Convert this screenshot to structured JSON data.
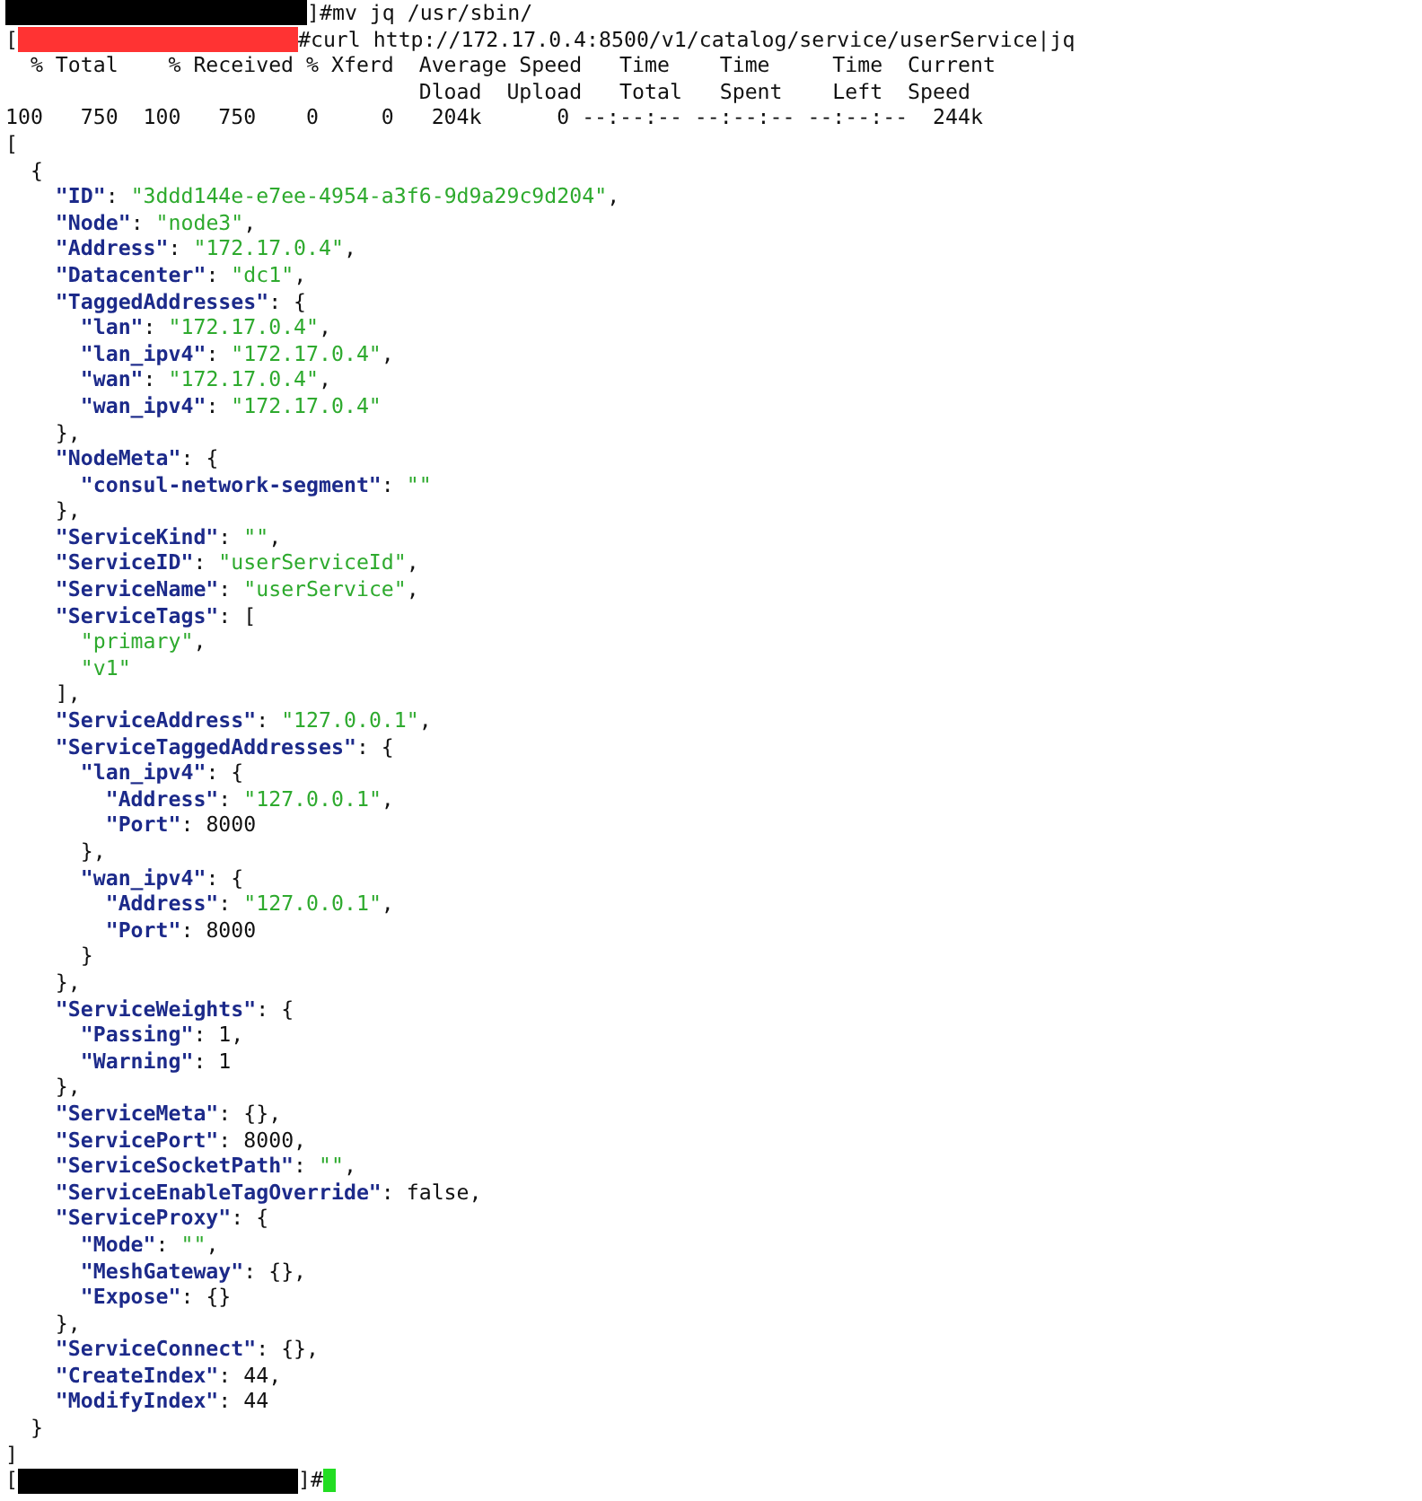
{
  "terminal": {
    "lines": [
      {
        "kind": "prompt",
        "color": "#000000",
        "command": "]#mv jq /usr/sbin/"
      },
      {
        "kind": "prompt",
        "prefix": "[",
        "color": "#ff3333",
        "command": "#curl http://172.17.0.4:8500/v1/catalog/service/userService|jq"
      },
      {
        "kind": "output",
        "text": "  % Total    % Received % Xferd  Average Speed   Time    Time     Time  Current"
      },
      {
        "kind": "output",
        "text": "                                 Dload  Upload   Total   Spent    Left  Speed"
      },
      {
        "kind": "output",
        "text": "100   750  100   750    0     0   204k      0 --:--:-- --:--:-- --:--:--  244k"
      },
      {
        "kind": "json",
        "tokens": [
          {
            "kind": "plain",
            "text": "["
          }
        ]
      },
      {
        "kind": "json",
        "tokens": [
          {
            "kind": "plain",
            "text": "  {"
          }
        ]
      },
      {
        "kind": "json",
        "tokens": [
          {
            "kind": "key",
            "text": "    \"ID\""
          },
          {
            "kind": "plain",
            "text": ": "
          },
          {
            "kind": "string",
            "text": "\"3ddd144e-e7ee-4954-a3f6-9d9a29c9d204\""
          },
          {
            "kind": "plain",
            "text": ","
          }
        ]
      },
      {
        "kind": "json",
        "tokens": [
          {
            "kind": "key",
            "text": "    \"Node\""
          },
          {
            "kind": "plain",
            "text": ": "
          },
          {
            "kind": "string",
            "text": "\"node3\""
          },
          {
            "kind": "plain",
            "text": ","
          }
        ]
      },
      {
        "kind": "json",
        "tokens": [
          {
            "kind": "key",
            "text": "    \"Address\""
          },
          {
            "kind": "plain",
            "text": ": "
          },
          {
            "kind": "string",
            "text": "\"172.17.0.4\""
          },
          {
            "kind": "plain",
            "text": ","
          }
        ]
      },
      {
        "kind": "json",
        "tokens": [
          {
            "kind": "key",
            "text": "    \"Datacenter\""
          },
          {
            "kind": "plain",
            "text": ": "
          },
          {
            "kind": "string",
            "text": "\"dc1\""
          },
          {
            "kind": "plain",
            "text": ","
          }
        ]
      },
      {
        "kind": "json",
        "tokens": [
          {
            "kind": "key",
            "text": "    \"TaggedAddresses\""
          },
          {
            "kind": "plain",
            "text": ": {"
          }
        ]
      },
      {
        "kind": "json",
        "tokens": [
          {
            "kind": "key",
            "text": "      \"lan\""
          },
          {
            "kind": "plain",
            "text": ": "
          },
          {
            "kind": "string",
            "text": "\"172.17.0.4\""
          },
          {
            "kind": "plain",
            "text": ","
          }
        ]
      },
      {
        "kind": "json",
        "tokens": [
          {
            "kind": "key",
            "text": "      \"lan_ipv4\""
          },
          {
            "kind": "plain",
            "text": ": "
          },
          {
            "kind": "string",
            "text": "\"172.17.0.4\""
          },
          {
            "kind": "plain",
            "text": ","
          }
        ]
      },
      {
        "kind": "json",
        "tokens": [
          {
            "kind": "key",
            "text": "      \"wan\""
          },
          {
            "kind": "plain",
            "text": ": "
          },
          {
            "kind": "string",
            "text": "\"172.17.0.4\""
          },
          {
            "kind": "plain",
            "text": ","
          }
        ]
      },
      {
        "kind": "json",
        "tokens": [
          {
            "kind": "key",
            "text": "      \"wan_ipv4\""
          },
          {
            "kind": "plain",
            "text": ": "
          },
          {
            "kind": "string",
            "text": "\"172.17.0.4\""
          }
        ]
      },
      {
        "kind": "json",
        "tokens": [
          {
            "kind": "plain",
            "text": "    },"
          }
        ]
      },
      {
        "kind": "json",
        "tokens": [
          {
            "kind": "key",
            "text": "    \"NodeMeta\""
          },
          {
            "kind": "plain",
            "text": ": {"
          }
        ]
      },
      {
        "kind": "json",
        "tokens": [
          {
            "kind": "key",
            "text": "      \"consul-network-segment\""
          },
          {
            "kind": "plain",
            "text": ": "
          },
          {
            "kind": "string",
            "text": "\"\""
          }
        ]
      },
      {
        "kind": "json",
        "tokens": [
          {
            "kind": "plain",
            "text": "    },"
          }
        ]
      },
      {
        "kind": "json",
        "tokens": [
          {
            "kind": "key",
            "text": "    \"ServiceKind\""
          },
          {
            "kind": "plain",
            "text": ": "
          },
          {
            "kind": "string",
            "text": "\"\""
          },
          {
            "kind": "plain",
            "text": ","
          }
        ]
      },
      {
        "kind": "json",
        "tokens": [
          {
            "kind": "key",
            "text": "    \"ServiceID\""
          },
          {
            "kind": "plain",
            "text": ": "
          },
          {
            "kind": "string",
            "text": "\"userServiceId\""
          },
          {
            "kind": "plain",
            "text": ","
          }
        ]
      },
      {
        "kind": "json",
        "tokens": [
          {
            "kind": "key",
            "text": "    \"ServiceName\""
          },
          {
            "kind": "plain",
            "text": ": "
          },
          {
            "kind": "string",
            "text": "\"userService\""
          },
          {
            "kind": "plain",
            "text": ","
          }
        ]
      },
      {
        "kind": "json",
        "tokens": [
          {
            "kind": "key",
            "text": "    \"ServiceTags\""
          },
          {
            "kind": "plain",
            "text": ": ["
          }
        ]
      },
      {
        "kind": "json",
        "tokens": [
          {
            "kind": "string",
            "text": "      \"primary\""
          },
          {
            "kind": "plain",
            "text": ","
          }
        ]
      },
      {
        "kind": "json",
        "tokens": [
          {
            "kind": "string",
            "text": "      \"v1\""
          }
        ]
      },
      {
        "kind": "json",
        "tokens": [
          {
            "kind": "plain",
            "text": "    ],"
          }
        ]
      },
      {
        "kind": "json",
        "tokens": [
          {
            "kind": "key",
            "text": "    \"ServiceAddress\""
          },
          {
            "kind": "plain",
            "text": ": "
          },
          {
            "kind": "string",
            "text": "\"127.0.0.1\""
          },
          {
            "kind": "plain",
            "text": ","
          }
        ]
      },
      {
        "kind": "json",
        "tokens": [
          {
            "kind": "key",
            "text": "    \"ServiceTaggedAddresses\""
          },
          {
            "kind": "plain",
            "text": ": {"
          }
        ]
      },
      {
        "kind": "json",
        "tokens": [
          {
            "kind": "key",
            "text": "      \"lan_ipv4\""
          },
          {
            "kind": "plain",
            "text": ": {"
          }
        ]
      },
      {
        "kind": "json",
        "tokens": [
          {
            "kind": "key",
            "text": "        \"Address\""
          },
          {
            "kind": "plain",
            "text": ": "
          },
          {
            "kind": "string",
            "text": "\"127.0.0.1\""
          },
          {
            "kind": "plain",
            "text": ","
          }
        ]
      },
      {
        "kind": "json",
        "tokens": [
          {
            "kind": "key",
            "text": "        \"Port\""
          },
          {
            "kind": "plain",
            "text": ": 8000"
          }
        ]
      },
      {
        "kind": "json",
        "tokens": [
          {
            "kind": "plain",
            "text": "      },"
          }
        ]
      },
      {
        "kind": "json",
        "tokens": [
          {
            "kind": "key",
            "text": "      \"wan_ipv4\""
          },
          {
            "kind": "plain",
            "text": ": {"
          }
        ]
      },
      {
        "kind": "json",
        "tokens": [
          {
            "kind": "key",
            "text": "        \"Address\""
          },
          {
            "kind": "plain",
            "text": ": "
          },
          {
            "kind": "string",
            "text": "\"127.0.0.1\""
          },
          {
            "kind": "plain",
            "text": ","
          }
        ]
      },
      {
        "kind": "json",
        "tokens": [
          {
            "kind": "key",
            "text": "        \"Port\""
          },
          {
            "kind": "plain",
            "text": ": 8000"
          }
        ]
      },
      {
        "kind": "json",
        "tokens": [
          {
            "kind": "plain",
            "text": "      }"
          }
        ]
      },
      {
        "kind": "json",
        "tokens": [
          {
            "kind": "plain",
            "text": "    },"
          }
        ]
      },
      {
        "kind": "json",
        "tokens": [
          {
            "kind": "key",
            "text": "    \"ServiceWeights\""
          },
          {
            "kind": "plain",
            "text": ": {"
          }
        ]
      },
      {
        "kind": "json",
        "tokens": [
          {
            "kind": "key",
            "text": "      \"Passing\""
          },
          {
            "kind": "plain",
            "text": ": 1,"
          }
        ]
      },
      {
        "kind": "json",
        "tokens": [
          {
            "kind": "key",
            "text": "      \"Warning\""
          },
          {
            "kind": "plain",
            "text": ": 1"
          }
        ]
      },
      {
        "kind": "json",
        "tokens": [
          {
            "kind": "plain",
            "text": "    },"
          }
        ]
      },
      {
        "kind": "json",
        "tokens": [
          {
            "kind": "key",
            "text": "    \"ServiceMeta\""
          },
          {
            "kind": "plain",
            "text": ": {},"
          }
        ]
      },
      {
        "kind": "json",
        "tokens": [
          {
            "kind": "key",
            "text": "    \"ServicePort\""
          },
          {
            "kind": "plain",
            "text": ": 8000,"
          }
        ]
      },
      {
        "kind": "json",
        "tokens": [
          {
            "kind": "key",
            "text": "    \"ServiceSocketPath\""
          },
          {
            "kind": "plain",
            "text": ": "
          },
          {
            "kind": "string",
            "text": "\"\""
          },
          {
            "kind": "plain",
            "text": ","
          }
        ]
      },
      {
        "kind": "json",
        "tokens": [
          {
            "kind": "key",
            "text": "    \"ServiceEnableTagOverride\""
          },
          {
            "kind": "plain",
            "text": ": false,"
          }
        ]
      },
      {
        "kind": "json",
        "tokens": [
          {
            "kind": "key",
            "text": "    \"ServiceProxy\""
          },
          {
            "kind": "plain",
            "text": ": {"
          }
        ]
      },
      {
        "kind": "json",
        "tokens": [
          {
            "kind": "key",
            "text": "      \"Mode\""
          },
          {
            "kind": "plain",
            "text": ": "
          },
          {
            "kind": "string",
            "text": "\"\""
          },
          {
            "kind": "plain",
            "text": ","
          }
        ]
      },
      {
        "kind": "json",
        "tokens": [
          {
            "kind": "key",
            "text": "      \"MeshGateway\""
          },
          {
            "kind": "plain",
            "text": ": {},"
          }
        ]
      },
      {
        "kind": "json",
        "tokens": [
          {
            "kind": "key",
            "text": "      \"Expose\""
          },
          {
            "kind": "plain",
            "text": ": {}"
          }
        ]
      },
      {
        "kind": "json",
        "tokens": [
          {
            "kind": "plain",
            "text": "    },"
          }
        ]
      },
      {
        "kind": "json",
        "tokens": [
          {
            "kind": "key",
            "text": "    \"ServiceConnect\""
          },
          {
            "kind": "plain",
            "text": ": {},"
          }
        ]
      },
      {
        "kind": "json",
        "tokens": [
          {
            "kind": "key",
            "text": "    \"CreateIndex\""
          },
          {
            "kind": "plain",
            "text": ": 44,"
          }
        ]
      },
      {
        "kind": "json",
        "tokens": [
          {
            "kind": "key",
            "text": "    \"ModifyIndex\""
          },
          {
            "kind": "plain",
            "text": ": 44"
          }
        ]
      },
      {
        "kind": "json",
        "tokens": [
          {
            "kind": "plain",
            "text": "  }"
          }
        ]
      },
      {
        "kind": "json",
        "tokens": [
          {
            "kind": "plain",
            "text": "]"
          }
        ]
      },
      {
        "kind": "prompt",
        "prefix": "[",
        "color": "#000000",
        "command": "]#",
        "cursor": true
      }
    ]
  }
}
